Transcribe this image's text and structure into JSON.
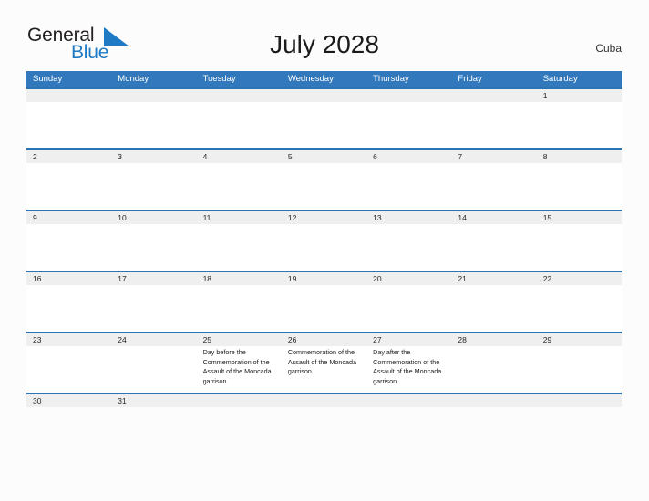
{
  "brand": {
    "name_part1": "General",
    "name_part2": "Blue",
    "flag_icon": "blue-flag-triangle-icon",
    "primary_color": "#1e7ac4"
  },
  "header": {
    "title": "July 2028",
    "country": "Cuba"
  },
  "theme": {
    "header_bar_color": "#3179bc",
    "row_divider_color": "#2b74b4",
    "daynum_band_color": "#efefef",
    "page_background": "#fcfcfc"
  },
  "calendar": {
    "weekdays": [
      "Sunday",
      "Monday",
      "Tuesday",
      "Wednesday",
      "Thursday",
      "Friday",
      "Saturday"
    ],
    "weeks": [
      {
        "days": [
          {
            "num": "",
            "event": ""
          },
          {
            "num": "",
            "event": ""
          },
          {
            "num": "",
            "event": ""
          },
          {
            "num": "",
            "event": ""
          },
          {
            "num": "",
            "event": ""
          },
          {
            "num": "",
            "event": ""
          },
          {
            "num": "1",
            "event": ""
          }
        ]
      },
      {
        "days": [
          {
            "num": "2",
            "event": ""
          },
          {
            "num": "3",
            "event": ""
          },
          {
            "num": "4",
            "event": ""
          },
          {
            "num": "5",
            "event": ""
          },
          {
            "num": "6",
            "event": ""
          },
          {
            "num": "7",
            "event": ""
          },
          {
            "num": "8",
            "event": ""
          }
        ]
      },
      {
        "days": [
          {
            "num": "9",
            "event": ""
          },
          {
            "num": "10",
            "event": ""
          },
          {
            "num": "11",
            "event": ""
          },
          {
            "num": "12",
            "event": ""
          },
          {
            "num": "13",
            "event": ""
          },
          {
            "num": "14",
            "event": ""
          },
          {
            "num": "15",
            "event": ""
          }
        ]
      },
      {
        "days": [
          {
            "num": "16",
            "event": ""
          },
          {
            "num": "17",
            "event": ""
          },
          {
            "num": "18",
            "event": ""
          },
          {
            "num": "19",
            "event": ""
          },
          {
            "num": "20",
            "event": ""
          },
          {
            "num": "21",
            "event": ""
          },
          {
            "num": "22",
            "event": ""
          }
        ]
      },
      {
        "days": [
          {
            "num": "23",
            "event": ""
          },
          {
            "num": "24",
            "event": ""
          },
          {
            "num": "25",
            "event": "Day before the Commemoration of the Assault of the Moncada garrison"
          },
          {
            "num": "26",
            "event": "Commemoration of the Assault of the Moncada garrison"
          },
          {
            "num": "27",
            "event": "Day after the Commemoration of the Assault of the Moncada garrison"
          },
          {
            "num": "28",
            "event": ""
          },
          {
            "num": "29",
            "event": ""
          }
        ]
      },
      {
        "days": [
          {
            "num": "30",
            "event": ""
          },
          {
            "num": "31",
            "event": ""
          },
          {
            "num": "",
            "event": ""
          },
          {
            "num": "",
            "event": ""
          },
          {
            "num": "",
            "event": ""
          },
          {
            "num": "",
            "event": ""
          },
          {
            "num": "",
            "event": ""
          }
        ]
      }
    ]
  }
}
